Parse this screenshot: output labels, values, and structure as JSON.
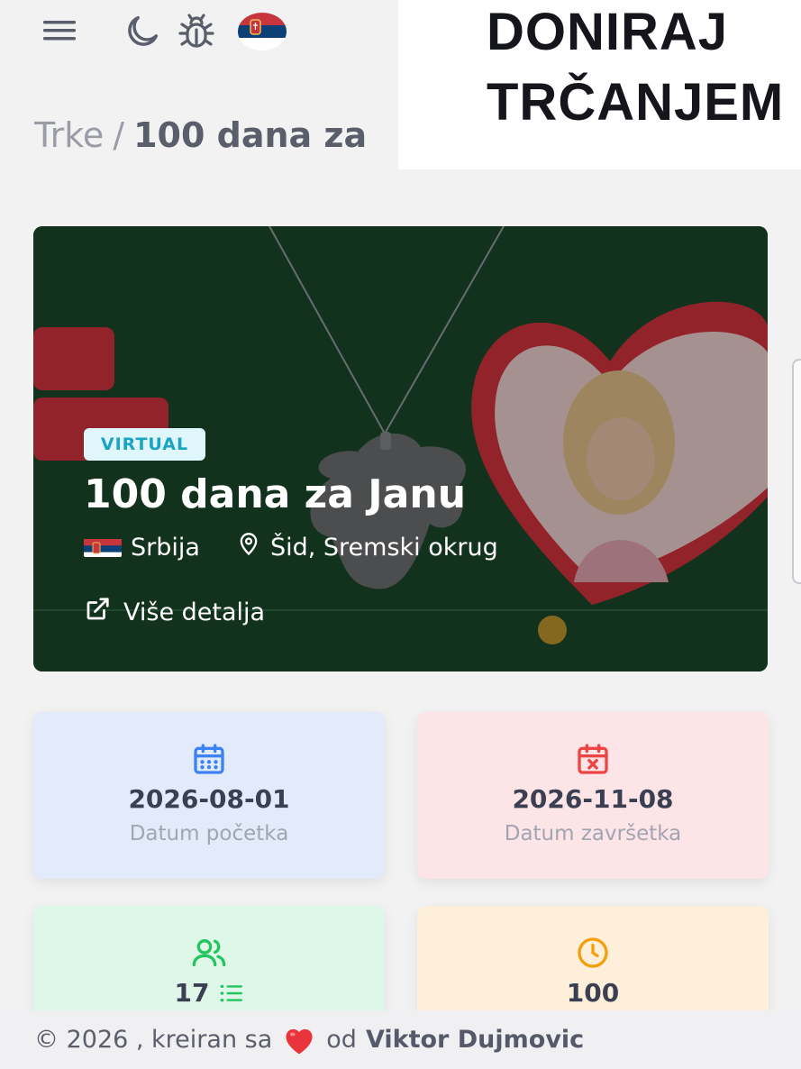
{
  "brand": {
    "line1": "DONIRAJ",
    "line2": "TRČANJEM"
  },
  "topbar": {
    "menu_icon": "hamburger-menu-icon",
    "theme_icon": "moon-icon",
    "bug_icon": "bug-icon",
    "language_icon": "serbia-flag-icon"
  },
  "breadcrumb": {
    "parent": "Trke",
    "separator": "/",
    "current": "100 dana za"
  },
  "hero": {
    "badge": "VIRTUAL",
    "title": "100 dana za Janu",
    "country": "Srbija",
    "location": "Šid, Sremski okrug",
    "details_link": "Više detalja"
  },
  "stats": {
    "start": {
      "value": "2026-08-01",
      "label": "Datum početka",
      "icon": "calendar-icon"
    },
    "end": {
      "value": "2026-11-08",
      "label": "Datum završetka",
      "icon": "calendar-x-icon"
    },
    "participants": {
      "value": "17",
      "icon": "users-icon",
      "list_icon": "list-icon"
    },
    "days": {
      "value": "100",
      "icon": "clock-icon"
    }
  },
  "footer": {
    "text": "© 2026 , kreiran sa",
    "by": "od",
    "author": "Viktor Dujmovic"
  },
  "colors": {
    "blue": "#3b82f6",
    "red": "#ef4444",
    "green": "#22c55e",
    "orange": "#f59e0b",
    "badge_text": "#1ba3c6"
  }
}
